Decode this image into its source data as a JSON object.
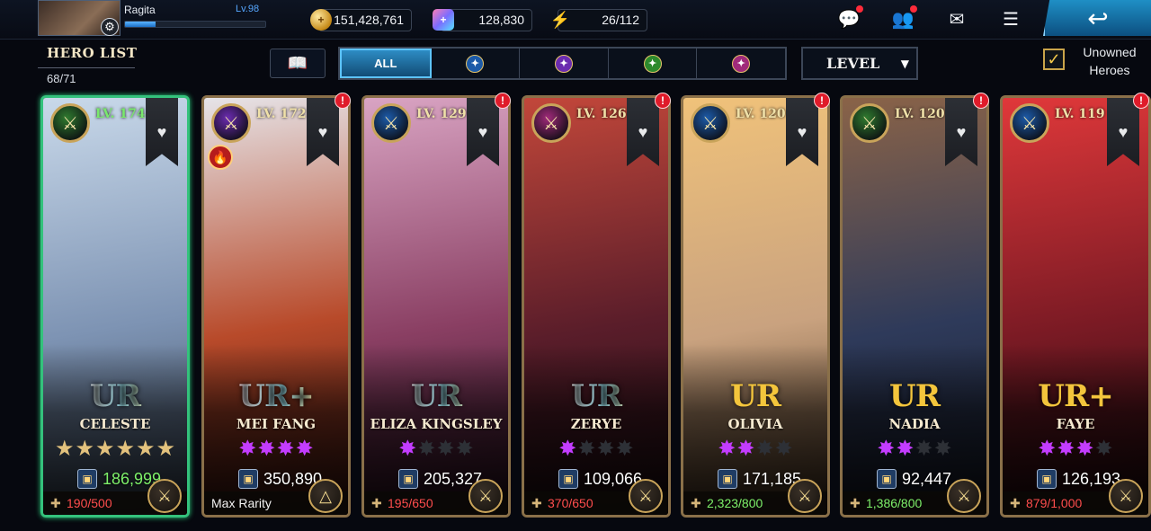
{
  "player": {
    "name": "Ragita",
    "level": "Lv.98",
    "xp_fraction": 0.22
  },
  "resources": {
    "gold": "151,428,761",
    "gems": "128,830",
    "stamina": "26/112"
  },
  "header": {
    "title": "HERO LIST",
    "count": "68/71"
  },
  "filters": {
    "tabs": [
      {
        "label": "ALL",
        "icon": "all",
        "active": true
      },
      {
        "label": "",
        "icon": "attack-class-icon",
        "color": "#1c5aa8"
      },
      {
        "label": "",
        "icon": "magic-class-icon",
        "color": "#6b2cb0"
      },
      {
        "label": "",
        "icon": "ranged-class-icon",
        "color": "#2d8a2d"
      },
      {
        "label": "",
        "icon": "support-class-icon",
        "color": "#a02a7a"
      }
    ],
    "sort_label": "LEVEL",
    "unowned_label": "Unowned Heroes",
    "unowned_checked": true
  },
  "heroes": [
    {
      "name": "CELESTE",
      "level": "LV. 174",
      "rarity": "UR",
      "rarity_style": "rainbow",
      "class_color": "#2f7a2f",
      "stars_type": "gold",
      "stars_filled": 6,
      "stars_total": 6,
      "power": "186,999",
      "power_green": true,
      "shards": "190/500",
      "shard_color": "red",
      "alert": false,
      "fire": false,
      "selected": true,
      "lv_green": true,
      "art": [
        "#c9d9ea",
        "#7d93b3",
        "#3d4a5b"
      ]
    },
    {
      "name": "MEI FANG",
      "level": "LV. 172",
      "rarity": "UR+",
      "rarity_style": "rainbow",
      "class_color": "#6b2cb0",
      "stars_type": "purple",
      "stars_filled": 4,
      "stars_total": 4,
      "power": "350,890",
      "power_green": false,
      "shards": "Max Rarity",
      "shard_color": "white",
      "alert": true,
      "fire": true,
      "selected": false,
      "lv_green": false,
      "art": [
        "#e6e4e8",
        "#b84a2a",
        "#3b1410"
      ]
    },
    {
      "name": "ELIZA KINGSLEY",
      "level": "LV. 129",
      "rarity": "UR",
      "rarity_style": "rainbow",
      "class_color": "#1c5aa8",
      "stars_type": "purple",
      "stars_filled": 1,
      "stars_total": 4,
      "power": "205,327",
      "power_green": false,
      "shards": "195/650",
      "shard_color": "red",
      "alert": true,
      "fire": false,
      "selected": false,
      "lv_green": false,
      "art": [
        "#d9a4c3",
        "#8a3f63",
        "#2a1020"
      ]
    },
    {
      "name": "ZERYE",
      "level": "LV. 126",
      "rarity": "UR",
      "rarity_style": "rainbow",
      "class_color": "#a02a7a",
      "stars_type": "purple",
      "stars_filled": 1,
      "stars_total": 4,
      "power": "109,066",
      "power_green": false,
      "shards": "370/650",
      "shard_color": "red",
      "alert": true,
      "fire": false,
      "selected": false,
      "lv_green": false,
      "art": [
        "#c2473a",
        "#5a1d2a",
        "#1c0d12"
      ]
    },
    {
      "name": "OLIVIA",
      "level": "LV. 120",
      "rarity": "UR",
      "rarity_style": "gold",
      "class_color": "#1c5aa8",
      "stars_type": "purple",
      "stars_filled": 2,
      "stars_total": 4,
      "power": "171,185",
      "power_green": false,
      "shards": "2,323/800",
      "shard_color": "green",
      "alert": true,
      "fire": false,
      "selected": false,
      "lv_green": false,
      "art": [
        "#f0c27a",
        "#c9a27f",
        "#4a3522"
      ]
    },
    {
      "name": "NADIA",
      "level": "LV. 120",
      "rarity": "UR",
      "rarity_style": "gold",
      "class_color": "#2f7a2f",
      "stars_type": "purple",
      "stars_filled": 2,
      "stars_total": 4,
      "power": "92,447",
      "power_green": false,
      "shards": "1,386/800",
      "shard_color": "green",
      "alert": true,
      "fire": false,
      "selected": false,
      "lv_green": false,
      "art": [
        "#8a6348",
        "#2e3a5a",
        "#161a26"
      ]
    },
    {
      "name": "FAYE",
      "level": "LV. 119",
      "rarity": "UR+",
      "rarity_style": "gold",
      "class_color": "#1c5aa8",
      "stars_type": "purple",
      "stars_filled": 3,
      "stars_total": 4,
      "power": "126,193",
      "power_green": false,
      "shards": "879/1,000",
      "shard_color": "red",
      "alert": true,
      "fire": false,
      "selected": false,
      "lv_green": false,
      "art": [
        "#e0383a",
        "#7a1a24",
        "#1e0a0e"
      ]
    }
  ]
}
